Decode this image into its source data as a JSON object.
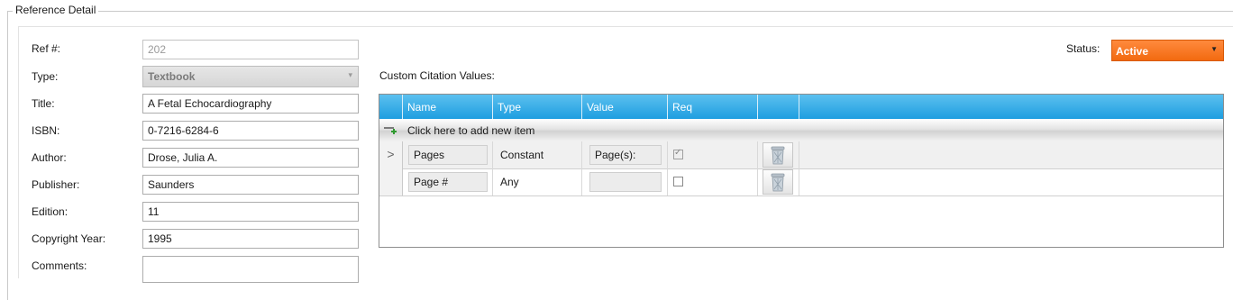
{
  "group": {
    "title": "Reference Detail"
  },
  "form": {
    "ref_label": "Ref #:",
    "ref_value": "202",
    "type_label": "Type:",
    "type_value": "Textbook",
    "title_label": "Title:",
    "title_value": "A Fetal Echocardiography",
    "isbn_label": "ISBN:",
    "isbn_value": "0-7216-6284-6",
    "author_label": "Author:",
    "author_value": "Drose, Julia A.",
    "publisher_label": "Publisher:",
    "publisher_value": "Saunders",
    "edition_label": "Edition:",
    "edition_value": "11",
    "year_label": "Copyright Year:",
    "year_value": "1995",
    "comments_label": "Comments:",
    "comments_value": ""
  },
  "status": {
    "label": "Status:",
    "value": "Active",
    "color": "#f26a10"
  },
  "citation": {
    "label": "Custom Citation Values:",
    "columns": [
      "Name",
      "Type",
      "Value",
      "Req"
    ],
    "add_text": "Click here to add new item",
    "rows": [
      {
        "name": "Pages",
        "type": "Constant",
        "value": "Page(s):",
        "req": true,
        "current": true,
        "indicator": ">"
      },
      {
        "name": "Page #",
        "type": "Any",
        "value": "",
        "req": false,
        "current": false,
        "indicator": ""
      }
    ]
  },
  "colors": {
    "header": "#1e9ee0",
    "accent": "#f26a10"
  },
  "icons": {
    "row_delete": "trash-icon",
    "add_row": "add-row-icon",
    "combo": "chevron-down-icon"
  }
}
